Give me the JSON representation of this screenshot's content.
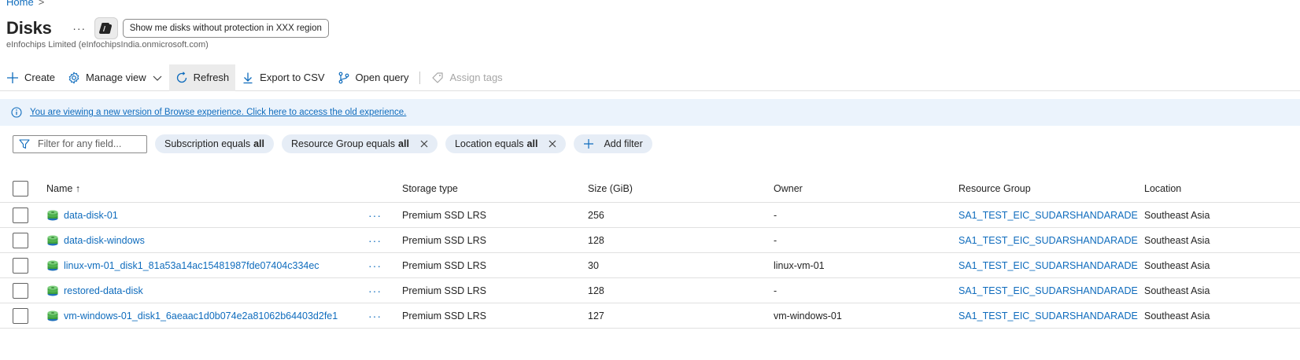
{
  "breadcrumb": {
    "home": "Home",
    "sep": ">"
  },
  "header": {
    "title": "Disks",
    "more": "···",
    "prompt": "Show me disks without protection in XXX region",
    "subtitle": "eInfochips Limited (eInfochipsIndia.onmicrosoft.com)"
  },
  "toolbar": {
    "create": "Create",
    "manage_view": "Manage view",
    "refresh": "Refresh",
    "export": "Export to CSV",
    "open_query": "Open query",
    "assign_tags": "Assign tags"
  },
  "banner": {
    "text": "You are viewing a new version of Browse experience. Click here to access the old experience."
  },
  "filters": {
    "placeholder": "Filter for any field...",
    "subscription": {
      "label": "Subscription equals",
      "value": "all"
    },
    "resource_group": {
      "label": "Resource Group equals",
      "value": "all"
    },
    "location": {
      "label": "Location equals",
      "value": "all"
    },
    "add": "Add filter"
  },
  "table": {
    "columns": {
      "name": "Name ↑",
      "storage": "Storage type",
      "size": "Size (GiB)",
      "owner": "Owner",
      "rg": "Resource Group",
      "location": "Location"
    },
    "row_more": "···",
    "rows": [
      {
        "name": "data-disk-01",
        "storage": "Premium SSD LRS",
        "size": "256",
        "owner": "-",
        "rg": "SA1_TEST_EIC_SUDARSHANDARADE",
        "location": "Southeast Asia"
      },
      {
        "name": "data-disk-windows",
        "storage": "Premium SSD LRS",
        "size": "128",
        "owner": "-",
        "rg": "SA1_TEST_EIC_SUDARSHANDARADE",
        "location": "Southeast Asia"
      },
      {
        "name": "linux-vm-01_disk1_81a53a14ac15481987fde07404c334ec",
        "storage": "Premium SSD LRS",
        "size": "30",
        "owner": "linux-vm-01",
        "rg": "SA1_TEST_EIC_SUDARSHANDARADE",
        "location": "Southeast Asia"
      },
      {
        "name": "restored-data-disk",
        "storage": "Premium SSD LRS",
        "size": "128",
        "owner": "-",
        "rg": "SA1_TEST_EIC_SUDARSHANDARADE",
        "location": "Southeast Asia"
      },
      {
        "name": "vm-windows-01_disk1_6aeaac1d0b074e2a81062b64403d2fe1",
        "storage": "Premium SSD LRS",
        "size": "127",
        "owner": "vm-windows-01",
        "rg": "SA1_TEST_EIC_SUDARSHANDARADE",
        "location": "Southeast Asia"
      }
    ]
  },
  "colors": {
    "accent": "#0f6cbd",
    "banner_bg": "#ebf3fc",
    "pill_bg": "#e6edf6"
  }
}
